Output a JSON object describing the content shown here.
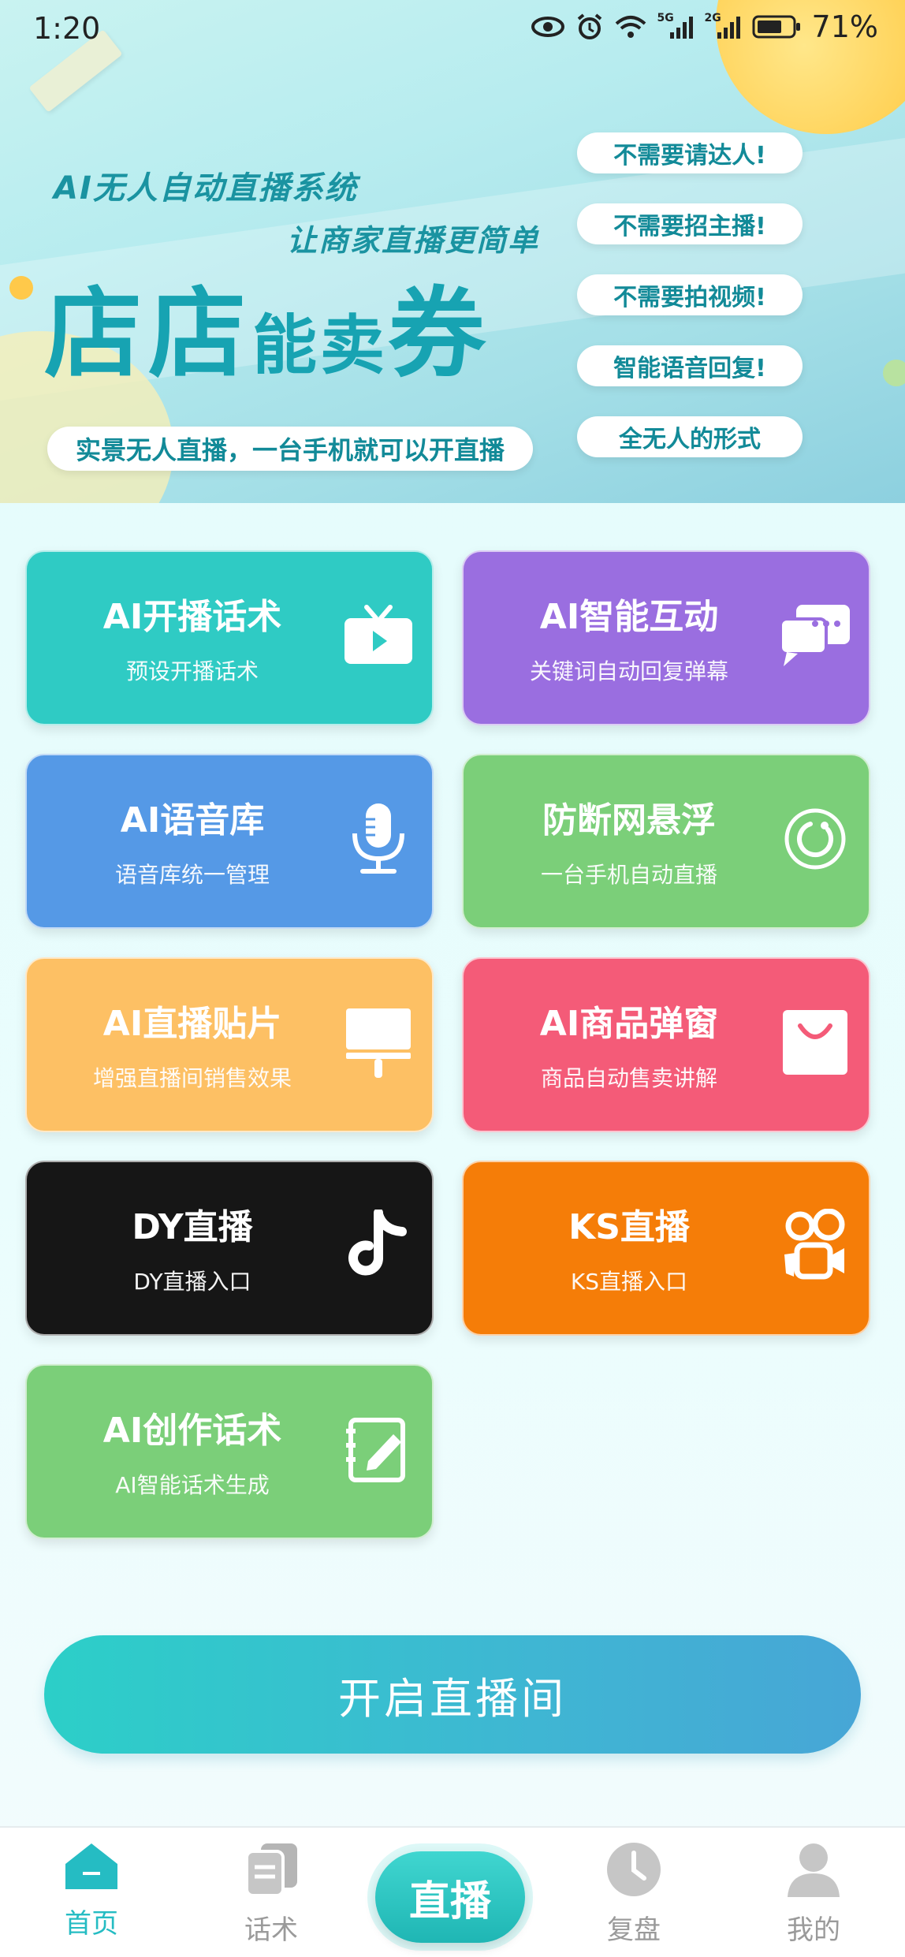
{
  "status_bar": {
    "time": "1:20",
    "network_5g": "5G",
    "network_2g": "2G",
    "battery": "71%"
  },
  "banner": {
    "line1": "AI无人自动直播系统",
    "line2": "让商家直播更简单",
    "brand_a": "店店",
    "brand_b": "能卖",
    "brand_c": "券",
    "tagline": "实景无人直播，一台手机就可以开直播",
    "pills": [
      "不需要请达人!",
      "不需要招主播!",
      "不需要拍视频!",
      "智能语音回复!",
      "全无人的形式"
    ]
  },
  "cards": [
    {
      "title": "AI开播话术",
      "subtitle": "预设开播话术",
      "icon": "tv-icon",
      "color": "#2fcbc4"
    },
    {
      "title": "AI智能互动",
      "subtitle": "关键词自动回复弹幕",
      "icon": "chat-bubbles-icon",
      "color": "#9a6ee0"
    },
    {
      "title": "AI语音库",
      "subtitle": "语音库统一管理",
      "icon": "microphone-icon",
      "color": "#5599e6"
    },
    {
      "title": "防断网悬浮",
      "subtitle": "一台手机自动直播",
      "icon": "refresh-circle-icon",
      "color": "#7bcf79"
    },
    {
      "title": "AI直播贴片",
      "subtitle": "增强直播间销售效果",
      "icon": "sign-board-icon",
      "color": "#fdc064"
    },
    {
      "title": "AI商品弹窗",
      "subtitle": "商品自动售卖讲解",
      "icon": "shopping-bag-icon",
      "color": "#f45b78"
    },
    {
      "title": "DY直播",
      "subtitle": "DY直播入口",
      "icon": "tiktok-icon",
      "color": "#161616"
    },
    {
      "title": "KS直播",
      "subtitle": "KS直播入口",
      "icon": "kuaishou-icon",
      "color": "#f57d08"
    },
    {
      "title": "AI创作话术",
      "subtitle": "AI智能话术生成",
      "icon": "edit-note-icon",
      "color": "#7bcf79"
    }
  ],
  "start_button": "开启直播间",
  "nav": {
    "home": "首页",
    "scripts": "话术",
    "live": "直播",
    "review": "复盘",
    "mine": "我的"
  }
}
